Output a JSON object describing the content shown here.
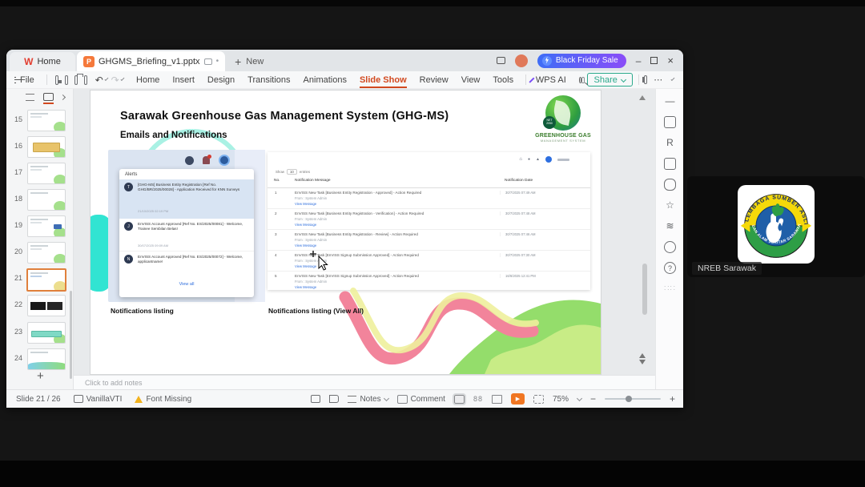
{
  "app": {
    "home_tab": "Home",
    "document_tab": "GHGMS_Briefing_v1.pptx",
    "new_tab_label": "New",
    "promo_button": "Black Friday Sale",
    "file_menu": "File",
    "menus": [
      "Home",
      "Insert",
      "Design",
      "Transitions",
      "Animations",
      "Slide Show",
      "Review",
      "View",
      "Tools",
      "WPS AI"
    ],
    "share_button": "Share",
    "slide_numbers": [
      "15",
      "16",
      "17",
      "18",
      "19",
      "20",
      "21",
      "22",
      "23",
      "24"
    ],
    "notes_placeholder": "Click to add notes",
    "status": {
      "slide_indicator": "Slide 21 / 26",
      "theme_name": "VanillaVTI",
      "font_warning": "Font Missing",
      "notes_button": "Notes",
      "comment_button": "Comment",
      "zoom_level": "75%"
    }
  },
  "slide": {
    "title": "Sarawak Greenhouse Gas Management System (GHG-MS)",
    "subtitle": "Emails and Notifications",
    "logo": {
      "badge_line1": "NET",
      "badge_line2": "2050",
      "name_line1": "GREENHOUSE GAS",
      "name_line2": "MANAGEMENT SYSTEM"
    },
    "alerts": {
      "title": "Alerts",
      "view_all": "View all",
      "items": [
        {
          "initial": "T",
          "text": "[GHG-MS] Business Entity Registration [Ref No. GHG/BR/2025/00028] - Application Received for KNN Surveys",
          "date": "21/10/2025 02:19 PM"
        },
        {
          "initial": "J",
          "text": "EnVISS Account Approved [Ref No. ES/2025/00081] - Welcome, Trainee Sembilan Belas!",
          "date": "30/07/2025 09:09 AM"
        },
        {
          "initial": "N",
          "text": "EnVISS Account Approved [Ref No. ES/2025/00072] - Welcome, applicantname!",
          "date": ""
        }
      ]
    },
    "table": {
      "show_label": "Show",
      "show_value": "10",
      "entries_label": "entries",
      "col_no": "No.",
      "col_message": "Notification Message",
      "col_date": "Notification Date",
      "from_text": "From : System Admin",
      "link_text": "View Message",
      "rows": [
        {
          "no": "1",
          "message": "EnVISS New Task [Business Entity Registration - Approved] - Action Required",
          "date": "30/7/2025 07:49 AM"
        },
        {
          "no": "2",
          "message": "EnVISS New Task [Business Entity Registration - Verification] - Action Required",
          "date": "30/7/2025 07:48 AM"
        },
        {
          "no": "3",
          "message": "EnVISS New Task [Business Entity Registration - Review] - Action Required",
          "date": "30/7/2025 07:46 AM"
        },
        {
          "no": "4",
          "message": "EnVISS New Task [EnVISS Signup Submission Approved] - Action Required",
          "date": "30/7/2025 07:30 AM"
        },
        {
          "no": "5",
          "message": "EnVISS New Task [EnVISS Signup Submission Approved] - Action Required",
          "date": "16/6/2025 12:41 PM"
        }
      ]
    },
    "caption_left": "Notifications listing",
    "caption_right": "Notifications listing (View All)"
  },
  "meeting": {
    "participant_name": "NREB Sarawak",
    "logo_text_top": "LEMBAGA SUMBER ASLI",
    "logo_text_bottom": "DAN ALAM SEKITAR SARAWAK"
  },
  "colors": {
    "accent_orange": "#d2491f",
    "share_teal": "#2aa98b",
    "link_blue": "#2f6fdd",
    "promo_start": "#3e6df6",
    "promo_end": "#8a4df8"
  }
}
